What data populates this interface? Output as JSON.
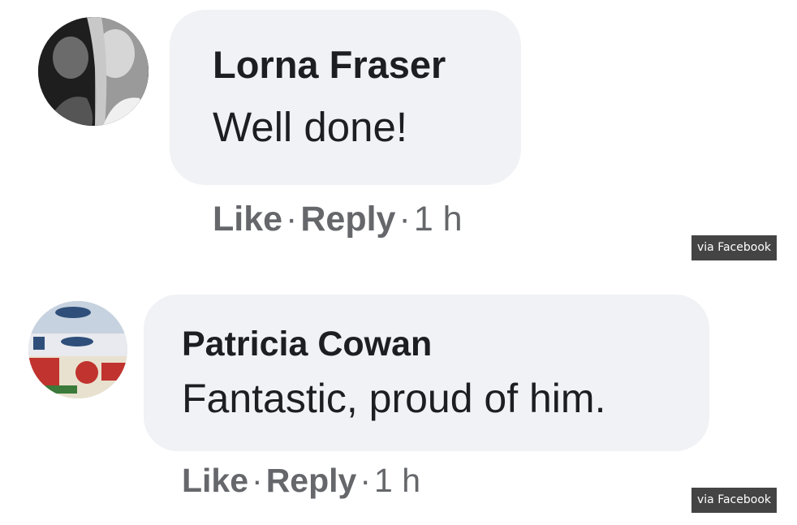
{
  "comments": [
    {
      "author": "Lorna Fraser",
      "text": "Well done!",
      "like_label": "Like",
      "reply_label": "Reply",
      "separator": "·",
      "time": "1 h"
    },
    {
      "author": "Patricia Cowan",
      "text": "Fantastic, proud of him.",
      "like_label": "Like",
      "reply_label": "Reply",
      "separator": "·",
      "time": "1 h"
    }
  ],
  "source_badge": "via Facebook",
  "colors": {
    "bubble": "#f0f2f5",
    "text": "#1c1e21",
    "meta": "#65676b",
    "badge_bg": "#444444",
    "badge_text": "#ffffff"
  }
}
